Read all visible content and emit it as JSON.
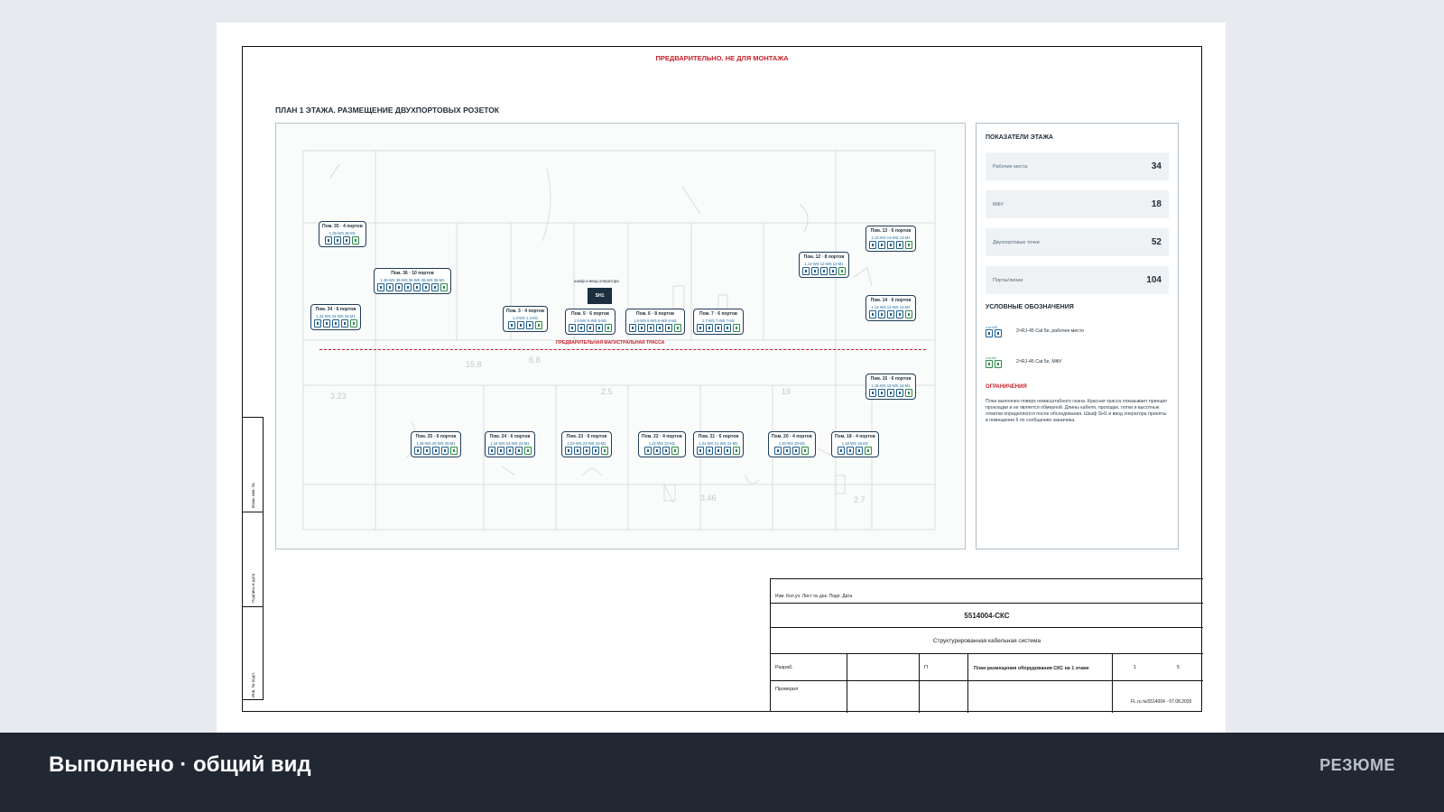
{
  "sheet": {
    "notice": "ПРЕДВАРИТЕЛЬНО. НЕ ДЛЯ МОНТАЖА",
    "plan_title": "ПЛАН 1 ЭТАЖА. РАЗМЕЩЕНИЕ ДВУХПОРТОВЫХ РОЗЕТОК",
    "trunk_label": "ПРЕДВАРИТЕЛЬНАЯ МАГИСТРАЛЬНАЯ ТРАССА",
    "cabinet": {
      "label": "SH1",
      "caption": "шкаф и ввод оператора"
    },
    "rooms": [
      {
        "id": "r35",
        "title": "Пом. 35 · 4 портов",
        "codes": "1.35-WS 35-M1",
        "ports": [
          "b",
          "b",
          "b",
          "g"
        ]
      },
      {
        "id": "r36",
        "title": "Пом. 36 · 10 портов",
        "codes": "1.36-WS 36-WS 36-WS 36-WS 36-M1",
        "ports": [
          "b",
          "b",
          "b",
          "b",
          "b",
          "b",
          "b",
          "g"
        ]
      },
      {
        "id": "r34",
        "title": "Пом. 34 · 6 портов",
        "codes": "1.34-WS 34-WS 34-M1",
        "ports": [
          "b",
          "b",
          "b",
          "b",
          "g"
        ]
      },
      {
        "id": "r3",
        "title": "Пом. 3 · 4 портов",
        "codes": "1.3-WS 1.3-M1",
        "ports": [
          "b",
          "b",
          "b",
          "g"
        ]
      },
      {
        "id": "r5",
        "title": "Пом. 5 · 6 портов",
        "codes": "1.5-WS 5-WS 5-M1",
        "ports": [
          "b",
          "b",
          "b",
          "b",
          "g"
        ]
      },
      {
        "id": "r6",
        "title": "Пом. 6 · 8 портов",
        "codes": "1.6-WS 6-WS 6-WS 6-M1",
        "ports": [
          "b",
          "b",
          "b",
          "b",
          "b",
          "g"
        ]
      },
      {
        "id": "r7",
        "title": "Пом. 7 · 6 портов",
        "codes": "1.7-WS 7-WS 7-M1",
        "ports": [
          "b",
          "b",
          "b",
          "b",
          "g"
        ]
      },
      {
        "id": "r12",
        "title": "Пом. 12 · 8 портов",
        "codes": "1.12-WS 12-WS 12-M1",
        "ports": [
          "b",
          "b",
          "b",
          "b",
          "g"
        ]
      },
      {
        "id": "r13",
        "title": "Пом. 13 · 6 портов",
        "codes": "1.13-WS 13-WS 13-M1",
        "ports": [
          "b",
          "b",
          "b",
          "b",
          "g"
        ]
      },
      {
        "id": "r14",
        "title": "Пом. 14 · 6 портов",
        "codes": "1.14-WS 14-WS 14-M1",
        "ports": [
          "b",
          "b",
          "b",
          "b",
          "g"
        ]
      },
      {
        "id": "r15",
        "title": "Пом. 15 · 6 портов",
        "codes": "1.15-WS 15-WS 15-M1",
        "ports": [
          "b",
          "b",
          "b",
          "b",
          "g"
        ]
      },
      {
        "id": "r25",
        "title": "Пом. 25 · 6 портов",
        "codes": "1.25-WS 25-WS 25-M1",
        "ports": [
          "b",
          "b",
          "b",
          "b",
          "g"
        ]
      },
      {
        "id": "r24",
        "title": "Пом. 24 · 6 портов",
        "codes": "1.24-WS 24-WS 24-M1",
        "ports": [
          "b",
          "b",
          "b",
          "b",
          "g"
        ]
      },
      {
        "id": "r23",
        "title": "Пом. 23 · 6 портов",
        "codes": "1.23-WS 23-WS 23-M1",
        "ports": [
          "b",
          "b",
          "b",
          "b",
          "g"
        ]
      },
      {
        "id": "r22",
        "title": "Пом. 22 · 4 портов",
        "codes": "1.22-WS 22-M1",
        "ports": [
          "b",
          "b",
          "b",
          "g"
        ]
      },
      {
        "id": "r21",
        "title": "Пом. 21 · 6 портов",
        "codes": "1.21-WS 21-WS 21-M1",
        "ports": [
          "b",
          "b",
          "b",
          "b",
          "g"
        ]
      },
      {
        "id": "r20",
        "title": "Пом. 20 · 4 портов",
        "codes": "1.20-WS 20-M1",
        "ports": [
          "b",
          "b",
          "b",
          "g"
        ]
      },
      {
        "id": "r18",
        "title": "Пом. 18 · 4 портов",
        "codes": "1.18-WS 18-M1",
        "ports": [
          "b",
          "b",
          "b",
          "g"
        ]
      }
    ],
    "panel": {
      "heading": "ПОКАЗАТЕЛИ ЭТАЖА",
      "kpis": [
        {
          "label": "Рабочие места",
          "value": "34"
        },
        {
          "label": "МФУ",
          "value": "18"
        },
        {
          "label": "Двухпортовые точки",
          "value": "52"
        },
        {
          "label": "Порты/линии",
          "value": "104"
        }
      ],
      "legend_heading": "УСЛОВНЫЕ ОБОЗНАЧЕНИЯ",
      "legend": [
        {
          "code": "x.xx-WS",
          "text": "2×RJ-45 Cat 5e, рабочее место"
        },
        {
          "code": "x.xx-M1",
          "text": "2×RJ-45 Cat 5e, МФУ"
        }
      ],
      "limits_heading": "ОГРАНИЧЕНИЯ",
      "limits_text": "План выполнен поверх немасштабного скана. Красная трасса показывает принцип прокладки и не является обмерной. Длины кабеля, проходки, лотки и высотные отметки определяются после обследования. Шкаф SH1 и ввод оператора приняты в помещении 5 по сообщению заказчика."
    },
    "side_strip": [
      "Взам. инв. №",
      "Подпись и дата",
      "Инв. № подл."
    ],
    "stamp": {
      "header_cols": "Изм.  Кол.уч.  Лист  № док.  Подп.  Дата",
      "code": "5514004-СКС",
      "system": "Структурированная кабельная система",
      "developed": "Разраб.",
      "checked": "Проверил",
      "stage": "П",
      "sheet_title": "План размещения оборудования СКС на 1 этаже",
      "sheet_no": "1",
      "sheets_total": "5",
      "footer": "FL.ru №5514004 · 07.08.2026"
    }
  },
  "bottom": {
    "title": "Выполнено · общий вид",
    "right_label": "РЕЗЮМЕ"
  }
}
